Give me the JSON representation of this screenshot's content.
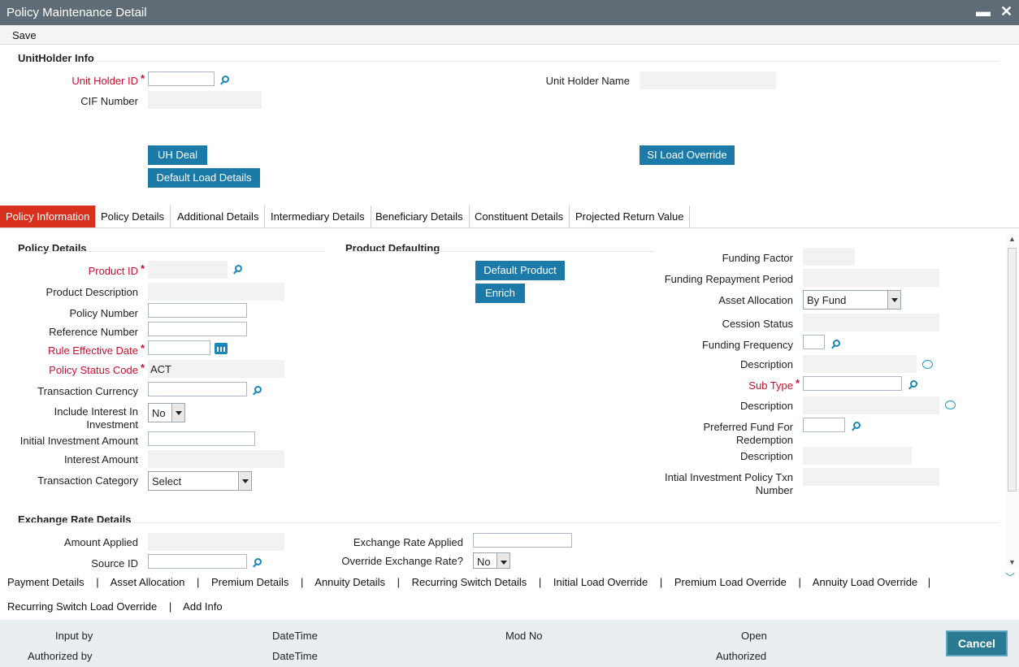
{
  "window": {
    "title": "Policy Maintenance Detail",
    "minimize": "▬",
    "close": "✕"
  },
  "toolbar": {
    "save": "Save"
  },
  "unitholder": {
    "section": "UnitHolder Info",
    "uh_id_label": "Unit Holder ID",
    "uh_name_label": "Unit Holder Name",
    "cif_label": "CIF Number",
    "uh_deal": "UH Deal",
    "default_load": "Default Load Details",
    "si_load": "SI Load Override"
  },
  "tabs": [
    "Policy Information",
    "Policy Details",
    "Additional Details",
    "Intermediary Details",
    "Beneficiary Details",
    "Constituent Details",
    "Projected Return Value"
  ],
  "policy": {
    "section": "Policy Details",
    "product_id": "Product ID",
    "product_desc": "Product Description",
    "policy_number": "Policy Number",
    "reference_number": "Reference Number",
    "rule_eff_date": "Rule Effective Date",
    "policy_status_code": "Policy Status Code",
    "policy_status_value": "ACT",
    "txn_currency": "Transaction Currency",
    "include_interest": "Include Interest In Investment",
    "include_interest_value": "No",
    "initial_inv_amt": "Initial Investment Amount",
    "interest_amt": "Interest Amount",
    "txn_category": "Transaction Category",
    "txn_category_value": "Select"
  },
  "product_defaulting": {
    "section": "Product Defaulting",
    "default_product": "Default Product",
    "enrich": "Enrich"
  },
  "right": {
    "funding_factor": "Funding Factor",
    "funding_repayment": "Funding Repayment Period",
    "asset_allocation": "Asset Allocation",
    "asset_allocation_value": "By Fund",
    "cession_status": "Cession Status",
    "funding_frequency": "Funding Frequency",
    "description1": "Description",
    "sub_type": "Sub Type",
    "description2": "Description",
    "preferred_fund": "Preferred Fund For Redemption",
    "description3": "Description",
    "initial_policy_txn": "Intial Investment Policy Txn Number"
  },
  "exchange": {
    "section": "Exchange Rate Details",
    "amount_applied": "Amount Applied",
    "source_id": "Source ID",
    "rate_applied": "Exchange Rate Applied",
    "override": "Override Exchange Rate?",
    "override_value": "No"
  },
  "links_row1": [
    "Payment Details",
    "Asset Allocation",
    "Premium Details",
    "Annuity Details",
    "Recurring Switch Details",
    "Initial Load Override",
    "Premium Load Override",
    "Annuity Load Override"
  ],
  "links_row2": [
    "Recurring Switch Load Override",
    "Add Info"
  ],
  "separator": "|",
  "footer": {
    "input_by": "Input by",
    "authorized_by": "Authorized by",
    "datetime1": "DateTime",
    "datetime2": "DateTime",
    "mod_no": "Mod No",
    "open": "Open",
    "authorized": "Authorized",
    "cancel": "Cancel"
  },
  "colors": {
    "titlebar": "#5f6c75",
    "button": "#1b7aa8",
    "active_tab": "#d8301c",
    "required": "#c8102e"
  }
}
